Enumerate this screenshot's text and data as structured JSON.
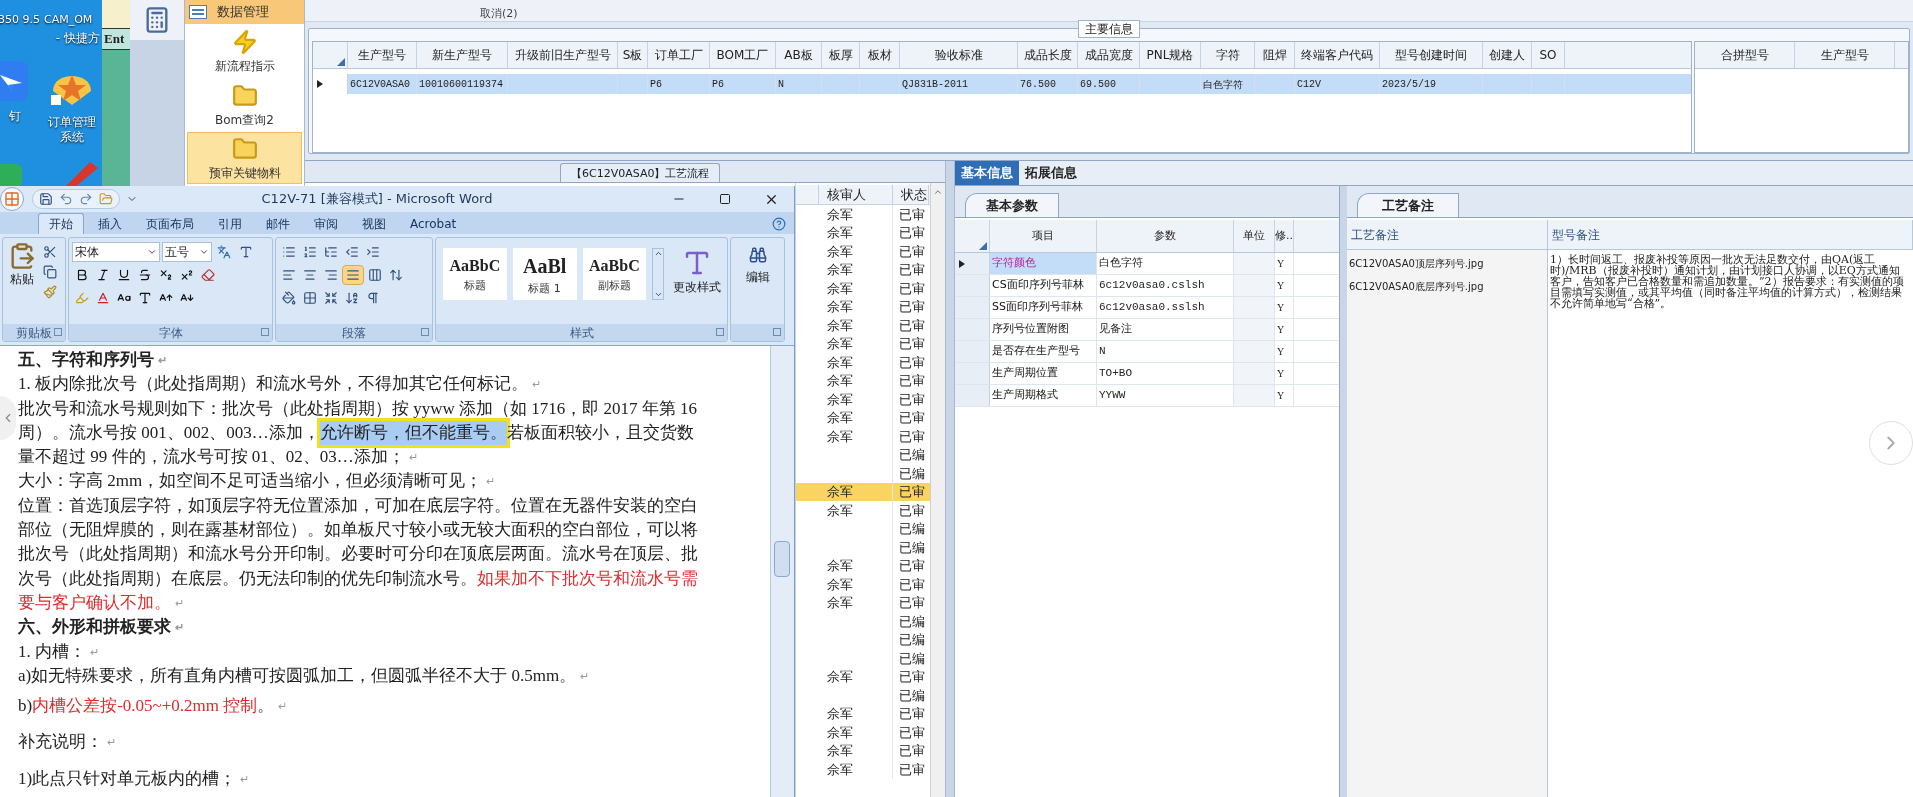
{
  "desktop": {
    "labels": [
      "350 9.5",
      "CAM_OM",
      "- 快捷方"
    ],
    "icons": [
      {
        "kind": "app",
        "label": "钉"
      },
      {
        "kind": "shell",
        "label": "订单管理系统"
      }
    ]
  },
  "back_window": {
    "title": "Ent"
  },
  "erp": {
    "sidebar": {
      "title": "数据管理",
      "items": [
        {
          "kind": "bolt",
          "label": "新流程指示",
          "selected": false
        },
        {
          "kind": "folder",
          "label": "Bom查询2",
          "selected": false
        },
        {
          "kind": "folder",
          "label": "预审关键物料",
          "selected": true
        }
      ]
    },
    "toolbar": {
      "label": "取消(2)"
    },
    "main_info": {
      "title": "主要信息",
      "columns": [
        "生产型号",
        "新生产型号",
        "升级前旧生产型号",
        "S板",
        "订单工厂",
        "BOM工厂",
        "AB板",
        "板厚",
        "板材",
        "验收标准",
        "成品长度",
        "成品宽度",
        "PNL规格",
        "字符",
        "阻焊",
        "终端客户代码",
        "型号创建时间",
        "创建人",
        "SO"
      ],
      "rows": [
        {
          "selected": true,
          "cells": [
            "6C12V0ASA0",
            "10010600119374",
            null,
            null,
            "P6",
            "P6",
            "N",
            null,
            null,
            "QJ831B-2011",
            "76.500",
            "69.500",
            null,
            "白色字符",
            null,
            "C12V",
            "2023/5/19",
            null,
            null
          ]
        }
      ],
      "side_columns": [
        "合拼型号",
        "生产型号"
      ]
    },
    "process": {
      "title": "【6C12V0ASA0】工艺流程",
      "columns": [
        "核审人",
        "状态"
      ],
      "rows": [
        {
          "reviewer": "佘军",
          "status": "已审",
          "selected": false
        },
        {
          "reviewer": "佘军",
          "status": "已审",
          "selected": false
        },
        {
          "reviewer": "佘军",
          "status": "已审",
          "selected": false
        },
        {
          "reviewer": "佘军",
          "status": "已审",
          "selected": false
        },
        {
          "reviewer": "佘军",
          "status": "已审",
          "selected": false
        },
        {
          "reviewer": "佘军",
          "status": "已审",
          "selected": false
        },
        {
          "reviewer": "佘军",
          "status": "已审",
          "selected": false
        },
        {
          "reviewer": "佘军",
          "status": "已审",
          "selected": false
        },
        {
          "reviewer": "佘军",
          "status": "已审",
          "selected": false
        },
        {
          "reviewer": "佘军",
          "status": "已审",
          "selected": false
        },
        {
          "reviewer": "佘军",
          "status": "已审",
          "selected": false
        },
        {
          "reviewer": "佘军",
          "status": "已审",
          "selected": false
        },
        {
          "reviewer": "佘军",
          "status": "已审",
          "selected": false
        },
        {
          "reviewer": null,
          "status": "已编",
          "selected": false
        },
        {
          "reviewer": null,
          "status": "已编",
          "selected": false
        },
        {
          "reviewer": "佘军",
          "status": "已审",
          "selected": true
        },
        {
          "reviewer": "佘军",
          "status": "已审",
          "selected": false
        },
        {
          "reviewer": null,
          "status": "已编",
          "selected": false
        },
        {
          "reviewer": null,
          "status": "已编",
          "selected": false
        },
        {
          "reviewer": "佘军",
          "status": "已审",
          "selected": false
        },
        {
          "reviewer": "佘军",
          "status": "已审",
          "selected": false
        },
        {
          "reviewer": "佘军",
          "status": "已审",
          "selected": false
        },
        {
          "reviewer": null,
          "status": "已编",
          "selected": false
        },
        {
          "reviewer": null,
          "status": "已编",
          "selected": false
        },
        {
          "reviewer": null,
          "status": "已编",
          "selected": false
        },
        {
          "reviewer": "佘军",
          "status": "已审",
          "selected": false
        },
        {
          "reviewer": null,
          "status": "已编",
          "selected": false
        },
        {
          "reviewer": "佘军",
          "status": "已审",
          "selected": false
        },
        {
          "reviewer": "佘军",
          "status": "已审",
          "selected": false
        },
        {
          "reviewer": "佘军",
          "status": "已审",
          "selected": false
        },
        {
          "reviewer": "佘军",
          "status": "已审",
          "selected": false
        }
      ]
    },
    "detail": {
      "tabs": [
        {
          "label": "基本信息",
          "selected": true
        },
        {
          "label": "拓展信息",
          "selected": false
        }
      ],
      "params": {
        "tab": "基本参数",
        "columns": [
          "项目",
          "参数",
          "单位",
          "修.."
        ],
        "rows": [
          {
            "item": "字符颜色",
            "value": "白色字符",
            "flag": "Y",
            "selected": true
          },
          {
            "item": "CS面印序列号菲林",
            "value": "6c12v0asa0.cslsh",
            "flag": "Y",
            "selected": false
          },
          {
            "item": "SS面印序列号菲林",
            "value": "6c12v0asa0.sslsh",
            "flag": "Y",
            "selected": false
          },
          {
            "item": "序列号位置附图",
            "value": "见备注",
            "flag": "Y",
            "selected": false
          },
          {
            "item": "是否存在生产型号",
            "value": "N",
            "flag": "Y",
            "selected": false
          },
          {
            "item": "生产周期位置",
            "value": "TO+BO",
            "flag": "Y",
            "selected": false
          },
          {
            "item": "生产周期格式",
            "value": "YYWW",
            "flag": "Y",
            "selected": false
          }
        ]
      },
      "notes": {
        "tab": "工艺备注",
        "columns": [
          "工艺备注",
          "型号备注"
        ],
        "files": [
          "6C12V0ASA0顶层序列号.jpg",
          "6C12V0ASA0底层序列号.jpg"
        ],
        "remark": "1）长时间返工、报废补投等原因一批次无法足数交付，由QA(返工时)/MRB（报废补投时）通知计划，由计划接口人协调，以EQ方式通知客户，告知客户已合格数量和需追加数量。”2）报告要求：有实测值的项目需填写实测值，或其平均值（同时备注平均值的计算方式），检测结果不允许简单地写“合格”。"
      }
    }
  },
  "word": {
    "title": "C12V-71 [兼容模式] - Microsoft Word",
    "tabs": [
      {
        "label": "开始",
        "selected": true
      },
      {
        "label": "插入",
        "selected": false
      },
      {
        "label": "页面布局",
        "selected": false
      },
      {
        "label": "引用",
        "selected": false
      },
      {
        "label": "邮件",
        "selected": false
      },
      {
        "label": "审阅",
        "selected": false
      },
      {
        "label": "视图",
        "selected": false
      },
      {
        "label": "Acrobat",
        "selected": false
      }
    ],
    "ribbon": {
      "paste": "粘贴",
      "font": "宋体",
      "size": "五号",
      "styles": [
        {
          "sample": "AaBbC",
          "label": "标题"
        },
        {
          "sample": "AaBl",
          "label": "标题 1"
        },
        {
          "sample": "AaBbC",
          "label": "副标题"
        }
      ],
      "change_styles": "更改样式",
      "edit": "编辑",
      "groups": [
        "剪贴板",
        "字体",
        "段落",
        "样式"
      ]
    },
    "document": {
      "lines": [
        {
          "kind": "heading",
          "runs": [
            {
              "kind": "plain",
              "text": "五、字符和序列号"
            },
            {
              "kind": "mark",
              "text": "↵"
            }
          ]
        },
        {
          "kind": "body",
          "runs": [
            {
              "kind": "plain",
              "text": "1. 板内除批次号（此处指周期）和流水号外，不得加其它任何标记。"
            },
            {
              "kind": "mark",
              "text": "↵"
            }
          ]
        },
        {
          "kind": "body",
          "runs": [
            {
              "kind": "plain",
              "text": "批次号和流水号规则如下：批次号（此处指周期）按 yyww 添加（如 1716，即 2017 年第 16"
            }
          ]
        },
        {
          "kind": "body",
          "runs": [
            {
              "kind": "plain",
              "text": "周）。流水号按 001、002、003…添加，"
            },
            {
              "kind": "selected",
              "text": "允许断号，但不能重号。"
            },
            {
              "kind": "plain",
              "text": "若板面积较小，且交货数"
            }
          ]
        },
        {
          "kind": "body",
          "runs": [
            {
              "kind": "plain",
              "text": "量不超过 99 件的，流水号可按 01、02、03…添加；"
            },
            {
              "kind": "mark",
              "text": "↵"
            }
          ]
        },
        {
          "kind": "body",
          "runs": [
            {
              "kind": "plain",
              "text": "大小：字高 2mm，如空间不足可适当缩小，但必须清晰可见；"
            },
            {
              "kind": "mark",
              "text": "↵"
            }
          ]
        },
        {
          "kind": "body",
          "runs": [
            {
              "kind": "plain",
              "text": "位置：首选顶层字符，如顶层字符无位置添加，可加在底层字符。位置在无器件安装的空白"
            }
          ]
        },
        {
          "kind": "body",
          "runs": [
            {
              "kind": "plain",
              "text": "部位（无阻焊膜的，则在露基材部位）。如单板尺寸较小或无较大面积的空白部位，可以将"
            }
          ]
        },
        {
          "kind": "body",
          "runs": [
            {
              "kind": "plain",
              "text": "批次号（此处指周期）和流水号分开印制。必要时可分印在顶底层两面。流水号在顶层、批"
            }
          ]
        },
        {
          "kind": "body",
          "runs": [
            {
              "kind": "plain",
              "text": "次号（此处指周期）在底层。仍无法印制的优先印制流水号。"
            },
            {
              "kind": "emphasis",
              "text": "如果加不下批次号和流水号需"
            }
          ]
        },
        {
          "kind": "body",
          "runs": [
            {
              "kind": "emphasis",
              "text": "要与客户确认不加。"
            },
            {
              "kind": "mark",
              "text": "↵"
            }
          ]
        },
        {
          "kind": "heading",
          "runs": [
            {
              "kind": "plain",
              "text": "六、外形和拼板要求"
            },
            {
              "kind": "mark",
              "text": "↵"
            }
          ]
        },
        {
          "kind": "body",
          "runs": [
            {
              "kind": "plain",
              "text": "1. 内槽："
            },
            {
              "kind": "mark",
              "text": "↵"
            }
          ]
        },
        {
          "kind": "body",
          "runs": [
            {
              "kind": "plain",
              "text": "a)如无特殊要求，所有直角内槽可按圆弧加工，但圆弧半径不大于 0.5mm。"
            },
            {
              "kind": "mark",
              "text": "↵"
            }
          ]
        },
        {
          "kind": "spaced",
          "runs": [
            {
              "kind": "plain",
              "text": "b)"
            },
            {
              "kind": "emphasis",
              "text": "内槽公差按-0.05~+0.2mm 控制"
            },
            {
              "kind": "plain",
              "text": "。"
            },
            {
              "kind": "mark",
              "text": "↵"
            }
          ]
        },
        {
          "kind": "gap",
          "runs": [
            {
              "kind": "plain",
              "text": "补充说明："
            },
            {
              "kind": "mark",
              "text": "↵"
            }
          ]
        },
        {
          "kind": "gap",
          "runs": [
            {
              "kind": "plain",
              "text": "1)此点只针对单元板内的槽；"
            },
            {
              "kind": "mark",
              "text": "↵"
            }
          ]
        }
      ]
    }
  }
}
